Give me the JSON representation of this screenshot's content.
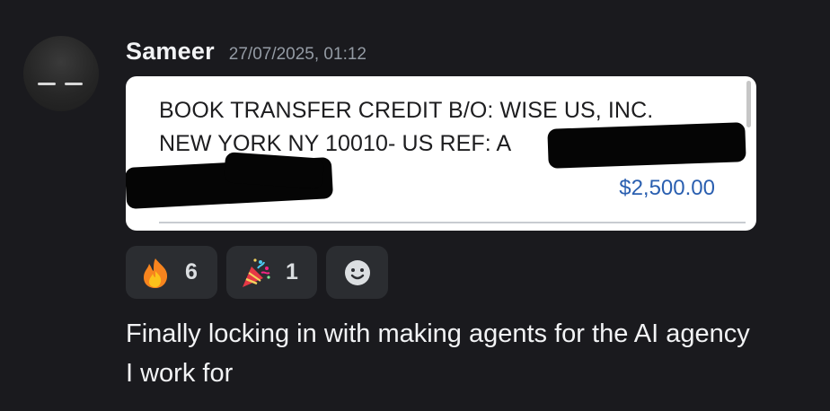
{
  "author": {
    "name": "Sameer",
    "timestamp": "27/07/2025, 01:12",
    "avatar_icon": "avatar-icon"
  },
  "embed": {
    "line1": "BOOK TRANSFER CREDIT B/O: WISE US, INC.",
    "line2": "NEW YORK NY 10010- US REF: A",
    "amount": "$2,500.00",
    "amount_color": "#2a5fb0"
  },
  "reactions": [
    {
      "emoji": "fire-emoji-icon",
      "count": "6"
    },
    {
      "emoji": "party-popper-emoji-icon",
      "count": "1"
    },
    {
      "emoji": "add-reaction-icon"
    }
  ],
  "message": {
    "text": "Finally locking in with making agents for the AI agency I work for"
  },
  "colors": {
    "background": "#1a1a1e",
    "reaction_bg": "#2b2d31",
    "timestamp": "#949ba4"
  }
}
